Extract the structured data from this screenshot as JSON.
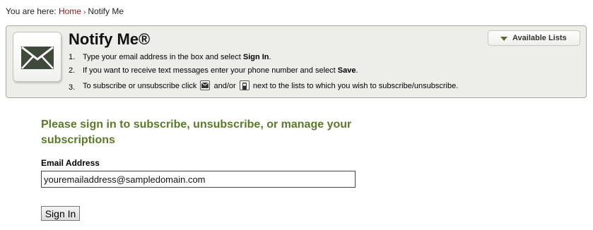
{
  "breadcrumb": {
    "prefix": "You are here:",
    "home": "Home",
    "separator": "›",
    "current": "Notify Me"
  },
  "panel": {
    "icon": "envelope-icon",
    "title": "Notify Me®",
    "lists_button": "Available Lists",
    "steps": [
      {
        "num": "1.",
        "pre": "Type your email address in the box and select ",
        "bold": "Sign In",
        "post": "."
      },
      {
        "num": "2.",
        "pre": "If you want to receive text messages enter your phone number and select ",
        "bold": "Save",
        "post": "."
      },
      {
        "num": "3.",
        "pre": "To subscribe or unsubscribe click ",
        "mid": " and/or ",
        "post": " next to the lists to which you wish to subscribe/unsubscribe.",
        "icon1": "email-subscribe-icon",
        "icon2": "phone-subscribe-icon"
      }
    ]
  },
  "signin": {
    "heading": "Please sign in to subscribe, unsubscribe, or manage your subscriptions",
    "email_label": "Email Address",
    "email_value": "youremailaddress@sampledomain.com",
    "button_label": "Sign In"
  },
  "colors": {
    "heading_green": "#5a7a2a",
    "panel_bg": "#ededea",
    "link": "#8b1a1a",
    "envelope": "#3f4a3a"
  }
}
